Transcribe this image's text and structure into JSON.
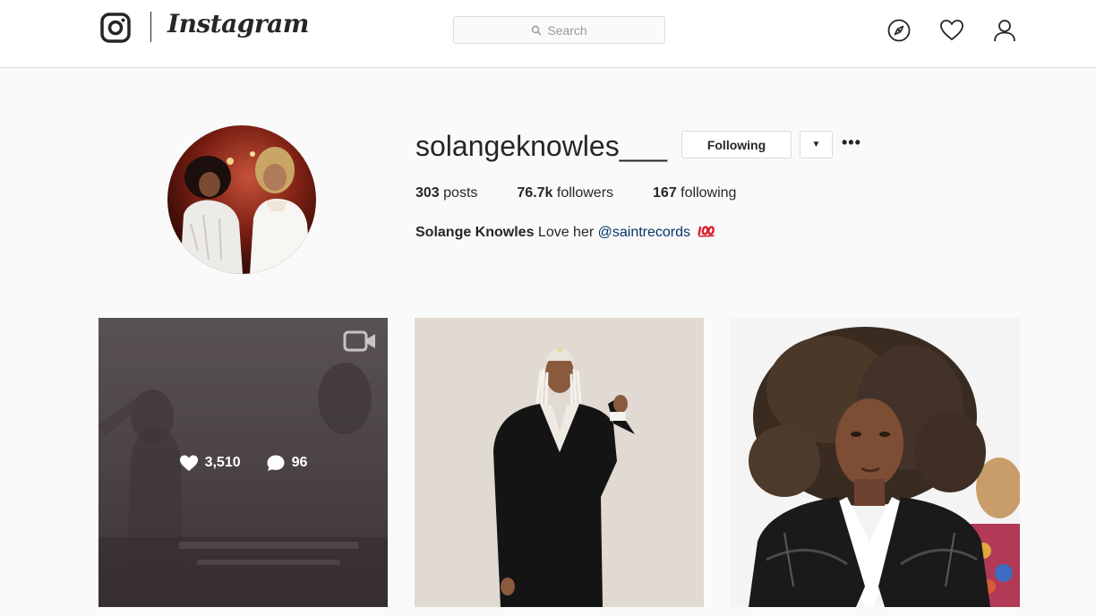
{
  "header": {
    "brand": "Instagram",
    "search_placeholder": "Search",
    "icons": [
      "instagram-camera-icon",
      "search-icon",
      "compass-icon",
      "heart-icon",
      "user-icon"
    ]
  },
  "profile": {
    "username": "solangeknowles___",
    "following_button": "Following",
    "dropdown_glyph": "▼",
    "more_glyph": "•••",
    "stats": {
      "posts_count": "303",
      "posts_label": " posts",
      "followers_count": "76.7k",
      "followers_label": " followers",
      "following_count": "167",
      "following_label": " following"
    },
    "bio": {
      "name": "Solange Knowles",
      "text": " Love her ",
      "mention": "@saintrecords",
      "emoji": "hundred-points-emoji"
    }
  },
  "posts": [
    {
      "type": "video",
      "likes": "3,510",
      "comments": "96",
      "icons": [
        "video-camera-icon",
        "heart-icon",
        "comment-icon"
      ]
    },
    {
      "type": "photo"
    },
    {
      "type": "photo"
    }
  ],
  "colors": {
    "link": "#003569",
    "border": "#dbdbdb",
    "background": "#fafafa",
    "emoji_red": "#d9232e"
  }
}
